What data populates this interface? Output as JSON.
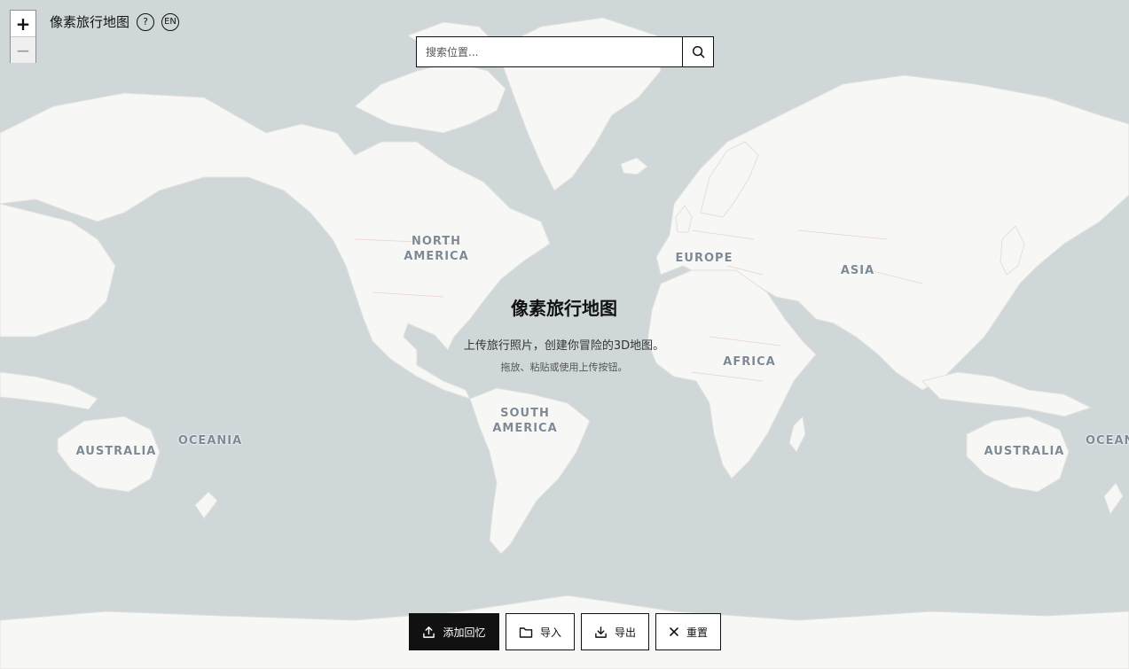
{
  "app": {
    "title": "像素旅行地图"
  },
  "header": {
    "help_label": "?",
    "lang_label": "EN"
  },
  "zoom": {
    "in_label": "+",
    "out_label": "−"
  },
  "search": {
    "placeholder": "搜索位置..."
  },
  "welcome": {
    "title": "像素旅行地图",
    "subtitle": "上传旅行照片，创建你冒险的3D地图。",
    "hint": "拖放、粘贴或使用上传按钮。"
  },
  "map_labels": {
    "north_america": "NORTH\nAMERICA",
    "europe": "EUROPE",
    "asia": "ASIA",
    "africa": "AFRICA",
    "south_america": "SOUTH\nAMERICA",
    "australia_left": "AUSTRALIA",
    "oceania_left": "OCEANIA",
    "australia_right": "AUSTRALIA",
    "oceania_right": "OCEAN"
  },
  "actions": {
    "add_memory": "添加回忆",
    "import": "导入",
    "export": "导出",
    "reset": "重置"
  },
  "icons": {
    "search": "search-icon",
    "upload": "upload-icon",
    "folder": "folder-icon",
    "download": "download-icon",
    "close": "close-icon"
  }
}
